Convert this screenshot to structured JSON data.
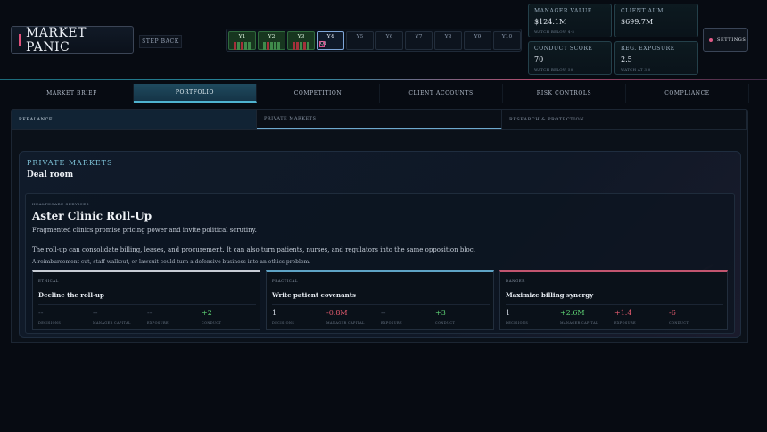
{
  "app": {
    "title": "MARKET PANIC",
    "step_back": "STEP BACK"
  },
  "timeline": {
    "years": [
      {
        "label": "Y1",
        "state": "done"
      },
      {
        "label": "Y2",
        "state": "done"
      },
      {
        "label": "Y3",
        "state": "done"
      },
      {
        "label": "Y4",
        "state": "current"
      },
      {
        "label": "Y5",
        "state": "future"
      },
      {
        "label": "Y6",
        "state": "future"
      },
      {
        "label": "Y7",
        "state": "future"
      },
      {
        "label": "Y8",
        "state": "future"
      },
      {
        "label": "Y9",
        "state": "future"
      },
      {
        "label": "Y10",
        "state": "future"
      }
    ],
    "current_marker": "Q1"
  },
  "metrics": {
    "manager_value": {
      "label": "MANAGER VALUE",
      "value": "$124.1M",
      "note": "WATCH BELOW $-5"
    },
    "client_aum": {
      "label": "CLIENT AUM",
      "value": "$699.7M",
      "note": ""
    },
    "conduct_score": {
      "label": "CONDUCT SCORE",
      "value": "70",
      "note": "WATCH BELOW 50"
    },
    "reg_exposure": {
      "label": "REG. EXPOSURE",
      "value": "2.5",
      "note": "WATCH AT 3.0"
    }
  },
  "settings_label": "SETTINGS",
  "nav": {
    "tabs": [
      "MARKET BRIEF",
      "PORTFOLIO",
      "COMPETITION",
      "CLIENT ACCOUNTS",
      "RISK CONTROLS",
      "COMPLIANCE"
    ],
    "active": "PORTFOLIO"
  },
  "subnav": {
    "tabs": [
      "REBALANCE",
      "PRIVATE MARKETS",
      "RESEARCH & PROTECTION"
    ]
  },
  "deal_room": {
    "kicker": "PRIVATE MARKETS",
    "title": "Deal room",
    "case": {
      "sector": "HEALTHCARE SERVICES",
      "title": "Aster Clinic Roll-Up",
      "tagline": "Fragmented clinics promise pricing power and invite political scrutiny.",
      "body": "The roll-up can consolidate billing, leases, and procurement. It can also turn patients, nurses, and regulators into the same opposition bloc.",
      "warning": "A reimbursement cut, staff walkout, or lawsuit could turn a defensive business into an ethics problem.",
      "stat_labels": [
        "DECISIONS",
        "MANAGER CAPITAL",
        "EXPOSURE",
        "CONDUCT"
      ],
      "choices": [
        {
          "type": "ETHICAL",
          "name": "Decline the roll-up",
          "values": [
            "--",
            "--",
            "--",
            "+2"
          ]
        },
        {
          "type": "PRACTICAL",
          "name": "Write patient covenants",
          "values": [
            "1",
            "-0.8M",
            "--",
            "+3"
          ]
        },
        {
          "type": "DANGER",
          "name": "Maximize billing synergy",
          "values": [
            "1",
            "+2.6M",
            "+1.4",
            "-6"
          ]
        }
      ]
    }
  },
  "colors": {
    "accent": "#4fb3cf",
    "positive": "#5ccf73",
    "negative": "#e25a6d",
    "danger": "#c2556f"
  }
}
